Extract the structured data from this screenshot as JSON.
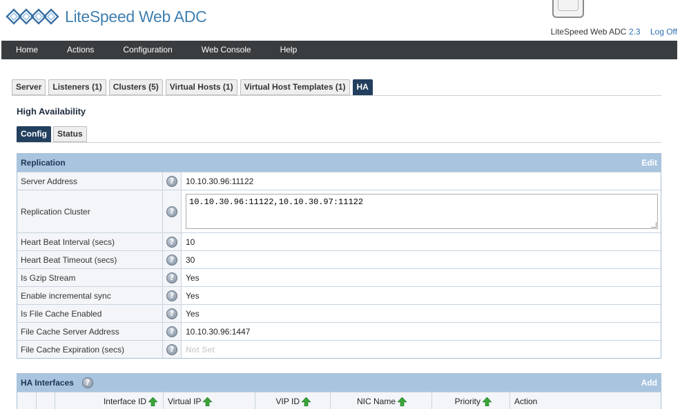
{
  "brand": {
    "name": "LiteSpeed Web ADC"
  },
  "product": {
    "name": "LiteSpeed Web ADC",
    "version": "2.3",
    "logoff": "Log Off"
  },
  "nav": [
    "Home",
    "Actions",
    "Configuration",
    "Web Console",
    "Help"
  ],
  "tabs": [
    "Server",
    "Listeners (1)",
    "Clusters (5)",
    "Virtual Hosts (1)",
    "Virtual Host Templates (1)",
    "HA"
  ],
  "active_tab": "HA",
  "section_title": "High Availability",
  "subtabs": [
    "Config",
    "Status"
  ],
  "replication": {
    "title": "Replication",
    "action": "Edit",
    "rows": [
      {
        "label": "Server Address",
        "value": "10.10.30.96:11122"
      },
      {
        "label": "Replication Cluster",
        "value": "10.10.30.96:11122,10.10.30.97:11122"
      },
      {
        "label": "Heart Beat Interval (secs)",
        "value": "10"
      },
      {
        "label": "Heart Beat Timeout (secs)",
        "value": "30"
      },
      {
        "label": "Is Gzip Stream",
        "value": "Yes"
      },
      {
        "label": "Enable incremental sync",
        "value": "Yes"
      },
      {
        "label": "Is File Cache Enabled",
        "value": "Yes"
      },
      {
        "label": "File Cache Server Address",
        "value": "10.10.30.96:1447"
      },
      {
        "label": "File Cache Expiration (secs)",
        "value": "Not Set"
      }
    ]
  },
  "ha_interfaces": {
    "title": "HA Interfaces",
    "action": "Add",
    "columns": [
      "Interface ID",
      "Virtual IP",
      "VIP ID",
      "NIC Name",
      "Priority",
      "Action"
    ]
  },
  "colors": {
    "nav_bg": "#3a3d40",
    "active_tab": "#223f5e",
    "table_header": "#a9c4df",
    "link": "#2f6fb0"
  }
}
